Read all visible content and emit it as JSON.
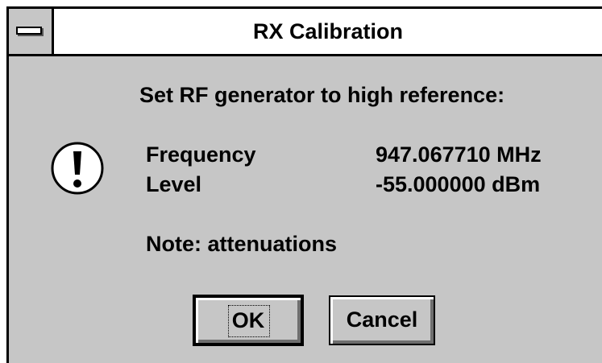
{
  "window": {
    "title": "RX Calibration"
  },
  "message": {
    "heading": "Set RF generator to high reference:",
    "frequency_label": "Frequency",
    "frequency_value": "947.067710 MHz",
    "level_label": "Level",
    "level_value": "-55.000000 dBm",
    "note": "Note: attenuations"
  },
  "icons": {
    "system_menu": "system-menu-icon",
    "alert": "exclamation-icon"
  },
  "buttons": {
    "ok_label": "OK",
    "cancel_label": "Cancel"
  },
  "colors": {
    "dialog_bg": "#c6c6c6",
    "titlebar_bg": "#ffffff",
    "border": "#000000"
  }
}
